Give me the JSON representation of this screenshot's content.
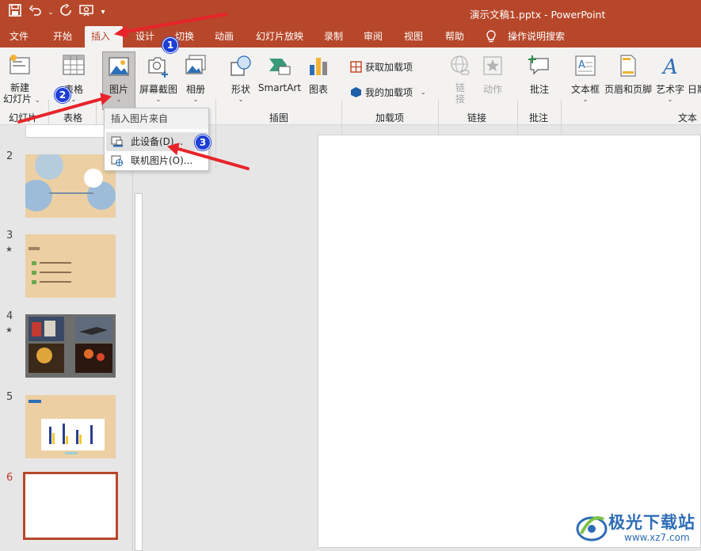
{
  "window": {
    "title": "演示文稿1.pptx  -  PowerPoint"
  },
  "qat": {
    "save": "💾",
    "undo": "↶",
    "undo_dd": "⌄",
    "redo": "↻",
    "present": "🖵",
    "customize": "▾"
  },
  "tabs": [
    "文件",
    "开始",
    "插入",
    "设计",
    "切换",
    "动画",
    "幻灯片放映",
    "录制",
    "审阅",
    "视图",
    "帮助",
    "操作说明搜索"
  ],
  "ribbon": {
    "new_slide": "新建\n幻灯片",
    "new_slide_line1": "新建",
    "new_slide_line2": "幻灯片",
    "table": "表格",
    "picture": "图片",
    "screenshot": "屏幕截图",
    "album": "相册",
    "shapes": "形状",
    "smartart": "SmartArt",
    "chart": "图表",
    "get_addins": "获取加载项",
    "my_addins": "我的加载项",
    "link": "链",
    "link2": "接",
    "action": "动作",
    "comment": "批注",
    "textbox": "文本框",
    "header_footer": "页眉和页脚",
    "wordart": "艺术字",
    "datetime": "日期",
    "groups": {
      "slides": "幻灯片",
      "tables": "表格",
      "images": "",
      "illustrations": "插图",
      "addins": "加载项",
      "links": "链接",
      "comments": "批注",
      "text": "文本"
    }
  },
  "menu": {
    "header": "插入图片来自",
    "item1": "此设备(D)...",
    "item2": "联机图片(O)..."
  },
  "slides": {
    "n2": "2",
    "n3": "3",
    "n4": "4",
    "n5": "5",
    "n6": "6",
    "star": "★"
  },
  "annotations": {
    "b1": "1",
    "b2": "2",
    "b3": "3"
  },
  "watermark": {
    "title": "极光下载站",
    "url": "www.xz7.com"
  },
  "colors": {
    "accent": "#b7472a",
    "badge": "#1d3fd6",
    "arrow": "#e8242a"
  }
}
